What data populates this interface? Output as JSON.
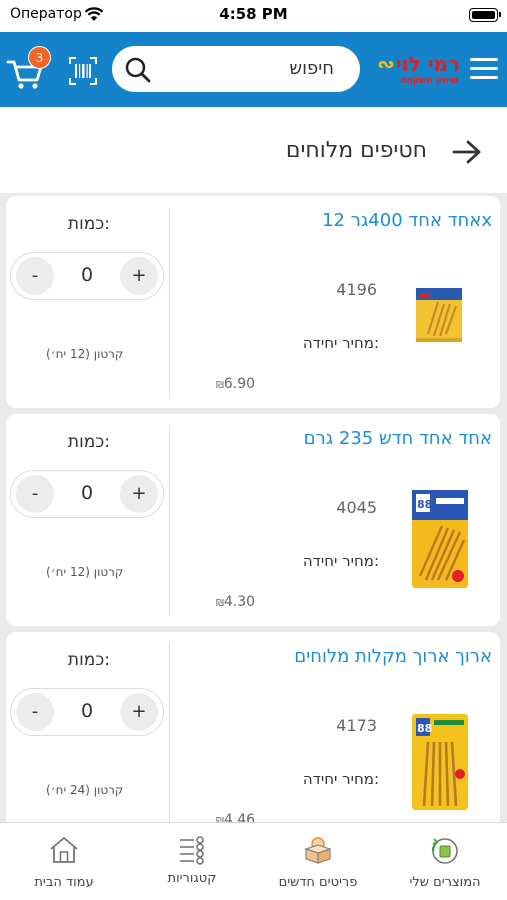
{
  "status_bar": {
    "carrier": "Оператор",
    "time": "4:58 PM"
  },
  "header": {
    "cart_badge": "3",
    "search_placeholder": "חיפוש",
    "logo_main": "רמי לוי",
    "logo_sub": "שיווק השקמה"
  },
  "page": {
    "title": "חטיפים מלוחים"
  },
  "products": [
    {
      "name": "אחד אחד 400גר 12x",
      "sku": "4196",
      "unit_price_label": "מחיר יחידה:",
      "price": "6.90",
      "currency": "₪",
      "qty_label": "כמות:",
      "qty": "0",
      "minus": "-",
      "plus": "+",
      "carton": "קרטון (12 יח׳)"
    },
    {
      "name": "אחד אחד חדש 235 גרם",
      "sku": "4045",
      "unit_price_label": "מחיר יחידה:",
      "price": "4.30",
      "currency": "₪",
      "qty_label": "כמות:",
      "qty": "0",
      "minus": "-",
      "plus": "+",
      "carton": "קרטון (12 יח׳)"
    },
    {
      "name": "ארוך ארוך מקלות מלוחים",
      "sku": "4173",
      "unit_price_label": "מחיר יחידה:",
      "price": "4.46",
      "currency": "₪",
      "qty_label": "כמות:",
      "qty": "0",
      "minus": "-",
      "plus": "+",
      "carton": "קרטון (24 יח׳)"
    }
  ],
  "bottom_nav": {
    "home": "עמוד הבית",
    "categories": "קטגוריות",
    "new_items": "פריטים חדשים",
    "my_products": "המוצרים שלי"
  },
  "colors": {
    "brand_blue": "#1483c9",
    "link_blue": "#1a8ed6",
    "badge_orange": "#f26522",
    "logo_red": "#e31e24"
  }
}
